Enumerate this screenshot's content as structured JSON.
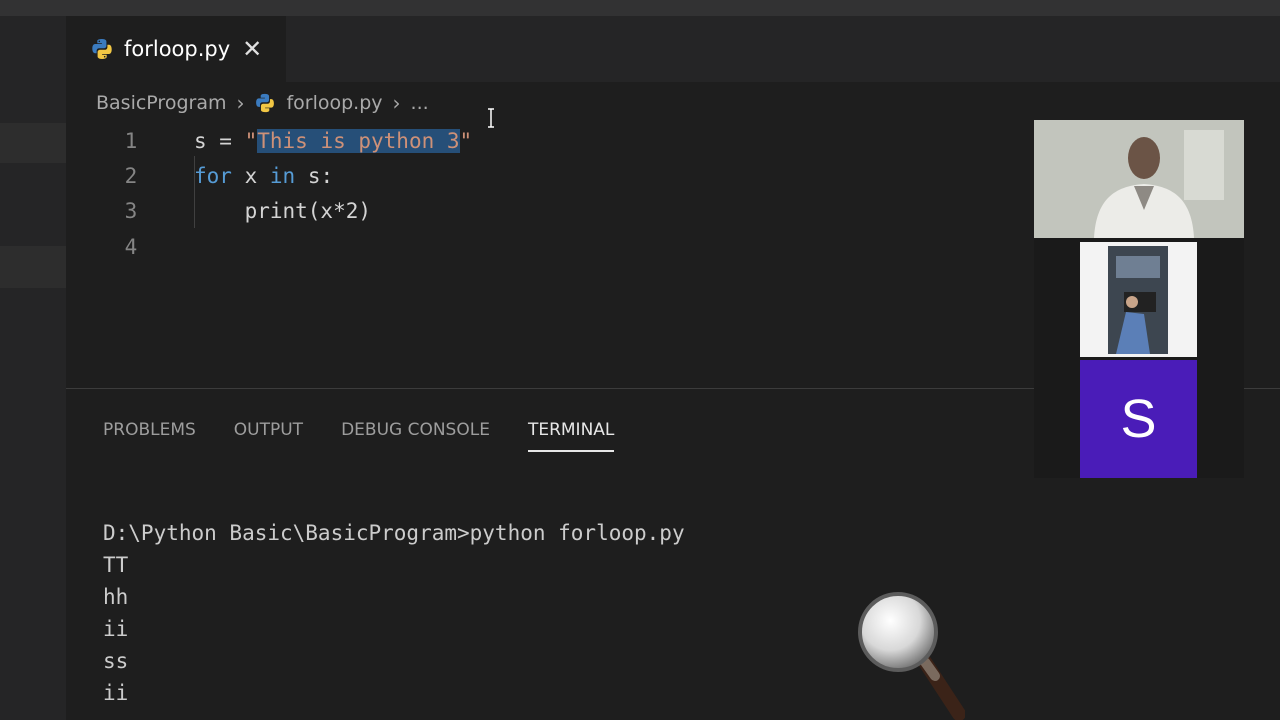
{
  "tab": {
    "label": "forloop.py",
    "close_glyph": "✕",
    "icon": "python-icon"
  },
  "breadcrumb": {
    "folder": "BasicProgram",
    "file": "forloop.py",
    "more": "..."
  },
  "editor": {
    "lines": [
      {
        "num": "1",
        "pre": "s = ",
        "q1": "\"",
        "selected": "This is python 3",
        "q2": "\""
      },
      {
        "num": "2",
        "kw1": "for",
        "mid": " x ",
        "kw2": "in",
        "rest": " s:"
      },
      {
        "num": "3",
        "code": "    print(x*2)"
      },
      {
        "num": "4",
        "code": ""
      }
    ]
  },
  "panel": {
    "tabs": [
      "PROBLEMS",
      "OUTPUT",
      "DEBUG CONSOLE",
      "TERMINAL"
    ],
    "active_tab": "TERMINAL"
  },
  "terminal": {
    "lines": [
      "D:\\Python Basic\\BasicProgram>python forloop.py",
      "TT",
      "hh",
      "ii",
      "ss",
      "ii"
    ]
  },
  "participants": {
    "avatar_letter": "S",
    "avatar_color": "#4a1cb8"
  },
  "colors": {
    "keyword": "#569cd6",
    "string": "#ce9178",
    "selection": "#264f78"
  }
}
